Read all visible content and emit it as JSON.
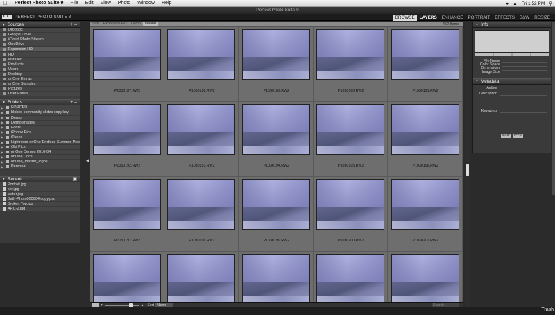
{
  "menubar": {
    "app_name": "Perfect Photo Suite 9",
    "items": [
      "File",
      "Edit",
      "View",
      "Photo",
      "Window",
      "Help"
    ],
    "clock": "Fri 1:52 PM"
  },
  "window": {
    "title": "Perfect Photo Suite 9"
  },
  "app": {
    "logo_mark": "OX1",
    "logo_text": "PERFECT PHOTO SUITE 8",
    "modules": [
      "BROWSE",
      "LAYERS",
      "ENHANCE",
      "PORTRAIT",
      "EFFECTS",
      "B&W",
      "RESIZE"
    ]
  },
  "left": {
    "sources_title": "Sources",
    "sources": [
      "Dropbox",
      "Google Drive",
      "iCloud Photo Stream",
      "OneDrive",
      "Expansion HD",
      "HD",
      "installer",
      "Products",
      "Users",
      "Desktop",
      "onOne Extras",
      "onOne Samples",
      "Pictures",
      "User Extras"
    ],
    "folders_title": "Folders",
    "folders": [
      "FORCED",
      "blokes-community-slides copy.key",
      "Demo",
      "Demo images",
      "Fonts",
      "iPhone Pics",
      "iTunes",
      "Lightroom-onOne-Endless-Summer-Preset...",
      "Old Pics",
      "onOne Demos 2010-04",
      "onOne Docs",
      "onOne_master_logos",
      "Personal"
    ],
    "recent_title": "Recent",
    "recent": [
      "Portrait.jpg",
      "sky.jpg",
      "water.jpg",
      "Bath-Photo000004 copy.psd",
      "Broken Top.jpg",
      "ARC-2.jpg"
    ]
  },
  "browser": {
    "toolbar": [
      "Sort",
      "Expansion HD",
      "Demo",
      "Ireland"
    ],
    "item_count": "452 Items",
    "thumbnails": [
      "P1030187.RW2",
      "P1030188.RW2",
      "P1030189.RW2",
      "P1030190.RW2",
      "P1030191.RW2",
      "P1030192.RW2",
      "P1030193.RW2",
      "P1030194.RW2",
      "P1030195.RW2",
      "P1030196.RW2",
      "P1030197.RW2",
      "P1030198.RW2",
      "P1030199.RW2",
      "P1030200.RW2",
      "P1030201.RW2",
      "",
      "",
      "",
      "",
      ""
    ],
    "sort_label": "Sort",
    "sort_value": "Name",
    "search_placeholder": "Search"
  },
  "right": {
    "info_title": "Info",
    "info_fields": [
      "File Name",
      "Color Space",
      "Dimensions",
      "Image Size"
    ],
    "metadata_title": "Metadata",
    "author_label": "Author",
    "description_label": "Description",
    "keywords_label": "Keywords",
    "meta_tabs": [
      "EXIF",
      "IPTC"
    ]
  },
  "desktop": {
    "label": "Trash"
  }
}
